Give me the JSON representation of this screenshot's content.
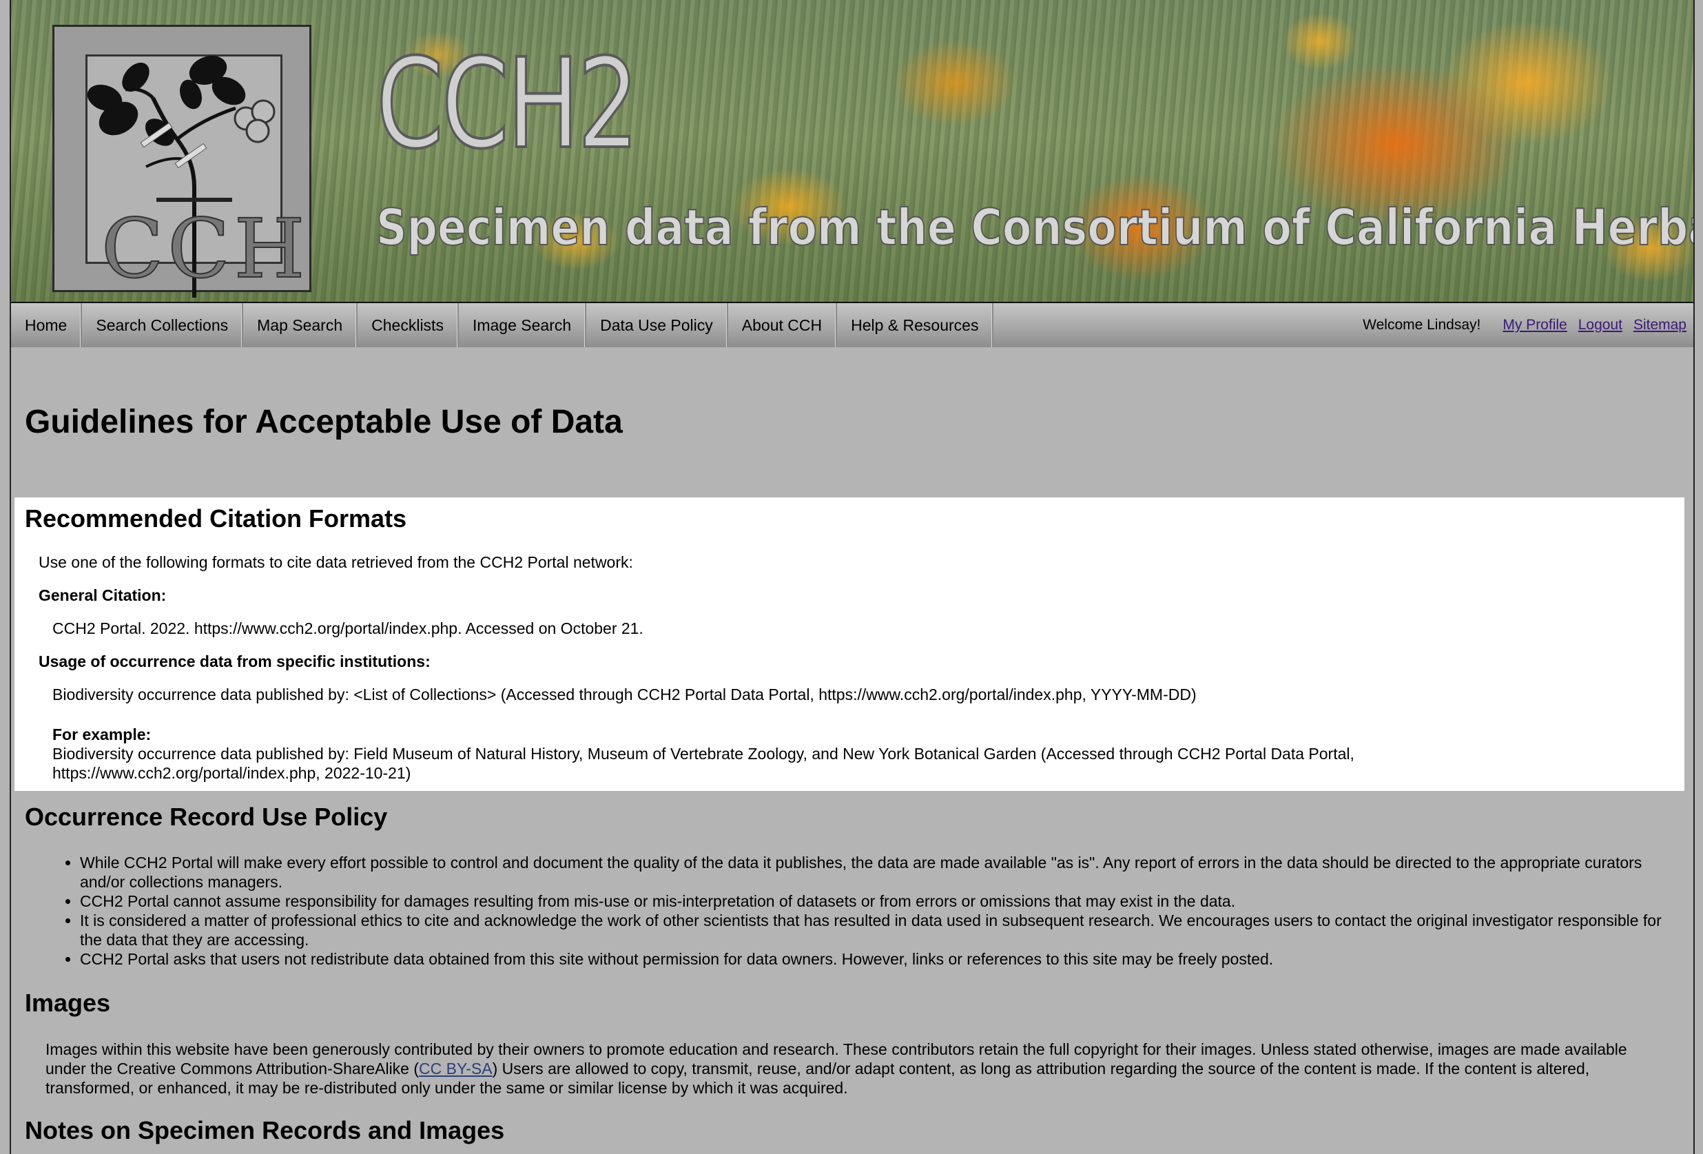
{
  "banner": {
    "logo_text": "CCH",
    "title": "CCH2",
    "subtitle": "Specimen data from the Consortium of California Herbaria"
  },
  "nav": {
    "items": [
      {
        "label": "Home"
      },
      {
        "label": "Search Collections"
      },
      {
        "label": "Map Search"
      },
      {
        "label": "Checklists"
      },
      {
        "label": "Image Search"
      },
      {
        "label": "Data Use Policy"
      },
      {
        "label": "About CCH"
      },
      {
        "label": "Help & Resources"
      }
    ],
    "welcome": "Welcome Lindsay!",
    "my_profile": "My Profile",
    "logout": "Logout",
    "sitemap": "Sitemap",
    "link_color": "#3a1a78"
  },
  "page_title": "Guidelines for Acceptable Use of Data",
  "citation": {
    "heading": "Recommended Citation Formats",
    "intro": "Use one of the following formats to cite data retrieved from the CCH2 Portal network:",
    "general_label": "General Citation:",
    "general_text": "CCH2 Portal. 2022. https://www.cch2.org/portal/index.php. Accessed on October 21.",
    "institutions_label": "Usage of occurrence data from specific institutions:",
    "institutions_text": "Biodiversity occurrence data published by: <List of Collections> (Accessed through CCH2 Portal Data Portal, https://www.cch2.org/portal/index.php, YYYY-MM-DD)",
    "example_label": "For example:",
    "example_line1": "Biodiversity occurrence data published by: Field Museum of Natural History, Museum of Vertebrate Zoology, and New York Botanical Garden (Accessed through CCH2 Portal Data Portal,",
    "example_line2": "https://www.cch2.org/portal/index.php, 2022-10-21)"
  },
  "policy": {
    "heading": "Occurrence Record Use Policy",
    "items": [
      "While CCH2 Portal will make every effort possible to control and document the quality of the data it publishes, the data are made available \"as is\". Any report of errors in the data should be directed to the appropriate curators and/or collections managers.",
      "CCH2 Portal cannot assume responsibility for damages resulting from mis-use or mis-interpretation of datasets or from errors or omissions that may exist in the data.",
      "It is considered a matter of professional ethics to cite and acknowledge the work of other scientists that has resulted in data used in subsequent research. We encourages users to contact the original investigator responsible for the data that they are accessing.",
      "CCH2 Portal asks that users not redistribute data obtained from this site without permission for data owners. However, links or references to this site may be freely posted."
    ]
  },
  "images": {
    "heading": "Images",
    "text_before": "Images within this website have been generously contributed by their owners to promote education and research. These contributors retain the full copyright for their images. Unless stated otherwise, images are made available under the Creative Commons Attribution-ShareAlike (",
    "link": "CC BY-SA",
    "text_after": ") Users are allowed to copy, transmit, reuse, and/or adapt content, as long as attribution regarding the source of the content is made. If the content is altered, transformed, or enhanced, it may be re-distributed only under the same or similar license by which it was acquired."
  },
  "notes": {
    "heading": "Notes on Specimen Records and Images"
  },
  "colors": {
    "page_background": "#b4b4b4",
    "panel_background": "#ffffff"
  }
}
